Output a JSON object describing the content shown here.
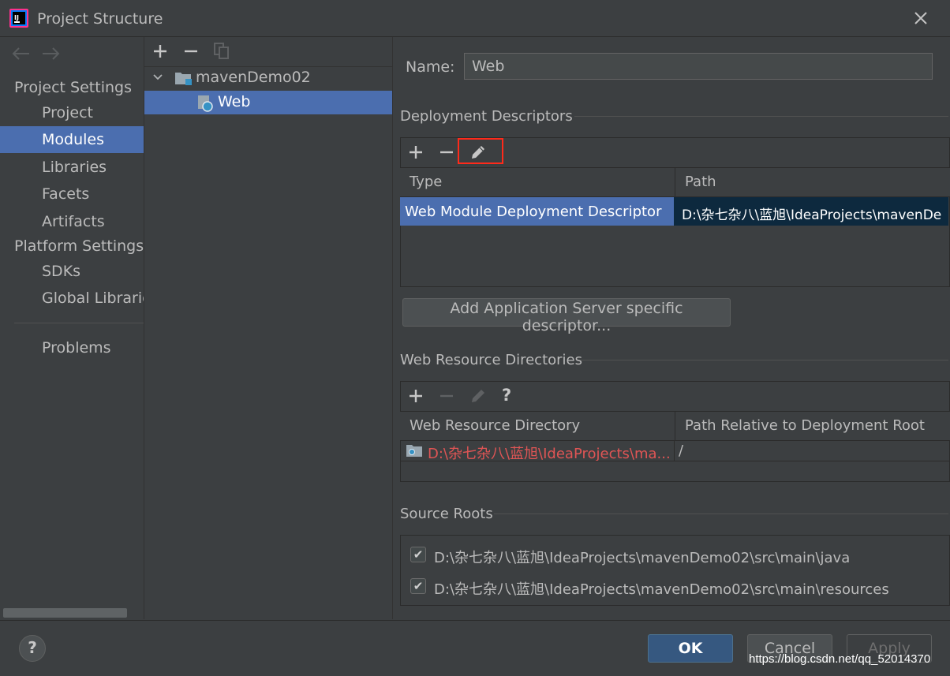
{
  "window": {
    "title": "Project Structure"
  },
  "nav": {
    "back_icon": "back-arrow-icon",
    "forward_icon": "forward-arrow-icon",
    "project_settings_label": "Project Settings",
    "project_items": [
      "Project",
      "Modules",
      "Libraries",
      "Facets",
      "Artifacts"
    ],
    "platform_settings_label": "Platform Settings",
    "platform_items": [
      "SDKs",
      "Global Libraries"
    ],
    "problems_label": "Problems",
    "selected": "Modules"
  },
  "modules_tree": {
    "root": "mavenDemo02",
    "child": "Web"
  },
  "facet": {
    "name_label": "Name:",
    "name_value": "Web",
    "deployment_descriptors": {
      "title": "Deployment Descriptors",
      "columns": [
        "Type",
        "Path"
      ],
      "rows": [
        {
          "type": "Web Module Deployment Descriptor",
          "path": "D:\\杂七杂八\\蓝旭\\IdeaProjects\\mavenDe"
        }
      ]
    },
    "add_server_button": "Add Application Server specific descriptor...",
    "web_resource_directories": {
      "title": "Web Resource Directories",
      "help_icon_text": "?",
      "columns": [
        "Web Resource Directory",
        "Path Relative to Deployment Root"
      ],
      "rows": [
        {
          "directory": "D:\\杂七杂八\\蓝旭\\IdeaProjects\\ma...",
          "relative": "/"
        }
      ]
    },
    "source_roots": {
      "title": "Source Roots",
      "items": [
        {
          "checked": true,
          "path": "D:\\杂七杂八\\蓝旭\\IdeaProjects\\mavenDemo02\\src\\main\\java"
        },
        {
          "checked": true,
          "path": "D:\\杂七杂八\\蓝旭\\IdeaProjects\\mavenDemo02\\src\\main\\resources"
        }
      ]
    }
  },
  "footer": {
    "help_text": "?",
    "ok_label": "OK",
    "cancel_label": "Cancel",
    "apply_label": "Apply",
    "watermark": "https://blog.csdn.net/qq_52014370"
  },
  "colors": {
    "background": "#3c3f41",
    "selection": "#4b6eaf",
    "error_red": "#e05555",
    "highlight_box": "#ff2a1a"
  }
}
